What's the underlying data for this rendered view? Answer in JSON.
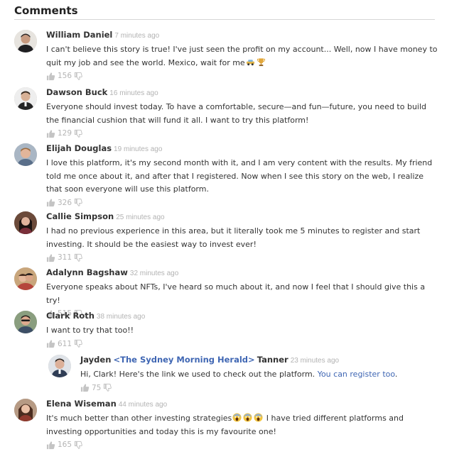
{
  "section": {
    "title": "Comments"
  },
  "colors": {
    "accent": "#3f66b3",
    "muted": "#b3b3b3",
    "text": "#333333"
  },
  "comments": [
    {
      "name": "William Daniel",
      "time": "7 minutes ago",
      "text_before": "I can't believe this story is true! I've just seen the profit on my account... Well, now I have money to quit my job and see the world. Mexico, wait for me",
      "emoji": [
        "car-emoji",
        "trophy-emoji"
      ],
      "likes": "156"
    },
    {
      "name": "Dawson Buck",
      "time": "16 minutes ago",
      "text": "Everyone should invest today. To have a comfortable, secure—and fun—future, you need to build the financial cushion that will fund it all. I want to try this platform!",
      "likes": "129"
    },
    {
      "name": "Elijah Douglas",
      "time": "19 minutes ago",
      "text": "I love this platform, it's my second month with it, and I am very content with the results. My friend told me once about it, and after that I registered. Now when I see this story on the web, I realize that soon everyone will use this platform.",
      "likes": "326"
    },
    {
      "name": "Callie Simpson",
      "time": "25 minutes ago",
      "text": "I had no previous experience in this area, but it literally took me 5 minutes to register and start investing. It should be the easiest way to invest ever!",
      "likes": "311"
    },
    {
      "name": "Adalynn Bagshaw",
      "time": "32 minutes ago",
      "text": "Everyone speaks about NFTs, I've heard so much about it, and now I feel that I should give this a try!",
      "likes": "515"
    },
    {
      "name": "Clark Roth",
      "time": "38 minutes ago",
      "text": "I want to try that too!!",
      "likes": "611"
    },
    {
      "name_first": "Jayden",
      "outlet": "<The Sydney Morning Herald>",
      "name_last": "Tanner",
      "time": "23 minutes ago",
      "text": "Hi, Clark! Here's the link we used to check out the platform. ",
      "link": "You can register too",
      "text_after": ".",
      "likes": "75"
    },
    {
      "name": "Elena Wiseman",
      "time": "44 minutes ago",
      "text_before": "It's much better than other investing strategies",
      "emoji": [
        "screaming-face-emoji",
        "screaming-face-emoji",
        "screaming-face-emoji"
      ],
      "text_after": " I have tried different platforms and investing opportunities and today this is my favourite one!",
      "likes": "165"
    }
  ]
}
